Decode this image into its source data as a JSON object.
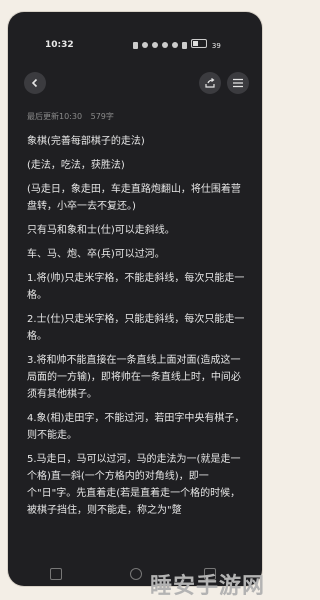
{
  "status_bar": {
    "time": "10:32",
    "battery_text": "39",
    "battery_level": 0.39
  },
  "toolbar": {
    "back_icon": "chevron-left-icon",
    "share_icon": "share-icon",
    "menu_icon": "hamburger-menu-icon"
  },
  "meta": {
    "updated": "最后更新10:30",
    "word_count": "579字"
  },
  "content": {
    "paragraphs": [
      "象棋(完善每部棋子的走法)",
      "(走法，吃法，获胜法)",
      "(马走日，象走田，车走直路炮翻山，将仕围着营盘转，小卒一去不复还。)",
      "只有马和象和士(仕)可以走斜线。",
      "车、马、炮、卒(兵)可以过河。",
      "1.将(帅)只走米字格，不能走斜线，每次只能走一格。",
      "2.士(仕)只走米字格，只能走斜线，每次只能走一格。",
      "3.将和帅不能直接在一条直线上面对面(造成这一局面的一方输)，即将帅在一条直线上时，中间必须有其他棋子。",
      "4.象(相)走田字，不能过河，若田字中央有棋子，则不能走。",
      "5.马走日，马可以过河，马的走法为一(就是走一个格)直一斜(一个方格内的对角线)，即一个\"日\"字。先直着走(若是直着走一个格的时候，被棋子挡住，则不能走，称之为\"蹩"
    ]
  },
  "watermark": {
    "text": "睡安手游网"
  }
}
